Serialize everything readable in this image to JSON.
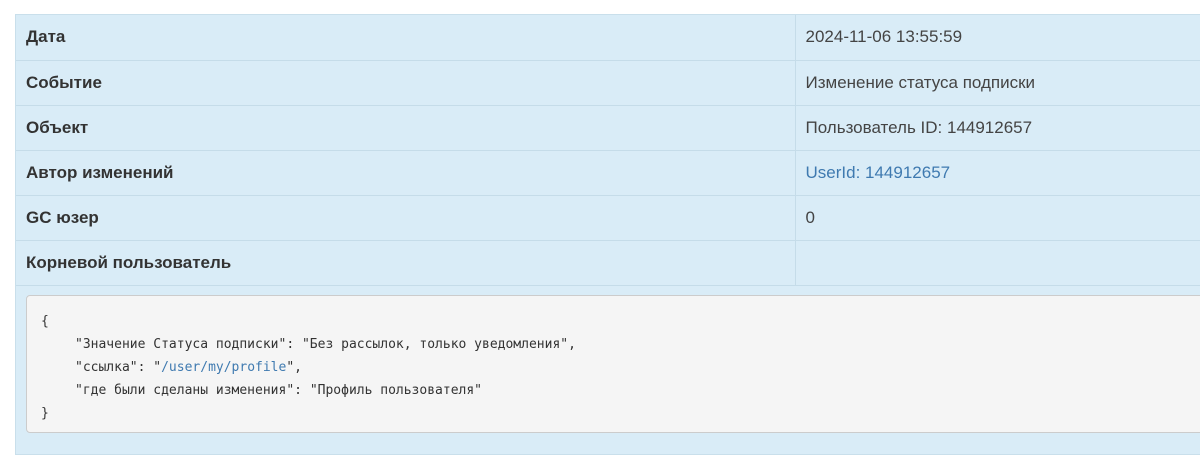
{
  "rows": [
    {
      "label": "Дата",
      "value": "2024-11-06 13:55:59",
      "link": false
    },
    {
      "label": "Событие",
      "value": "Изменение статуса подписки",
      "link": false
    },
    {
      "label": "Объект",
      "value": "Пользователь ID: 144912657",
      "link": false
    },
    {
      "label": "Автор изменений",
      "value": "UserId: 144912657",
      "link": true
    },
    {
      "label": "GC юзер",
      "value": "0",
      "link": false
    },
    {
      "label": "Корневой пользователь",
      "value": "",
      "link": false
    }
  ],
  "details": {
    "open_brace": "{",
    "close_brace": "}",
    "line1_key": "\"Значение Статуса подписки\"",
    "line1_value": "\"Без рассылок, только уведомления\"",
    "line2_key": "\"ссылка\"",
    "line2_link": "/user/my/profile",
    "line3_key": "\"где были сделаны изменения\"",
    "line3_value": "\"Профиль пользователя\""
  },
  "colors": {
    "panel_bg": "#d9ecf7",
    "link": "#3f7ab0",
    "code_bg": "#f5f5f5"
  }
}
